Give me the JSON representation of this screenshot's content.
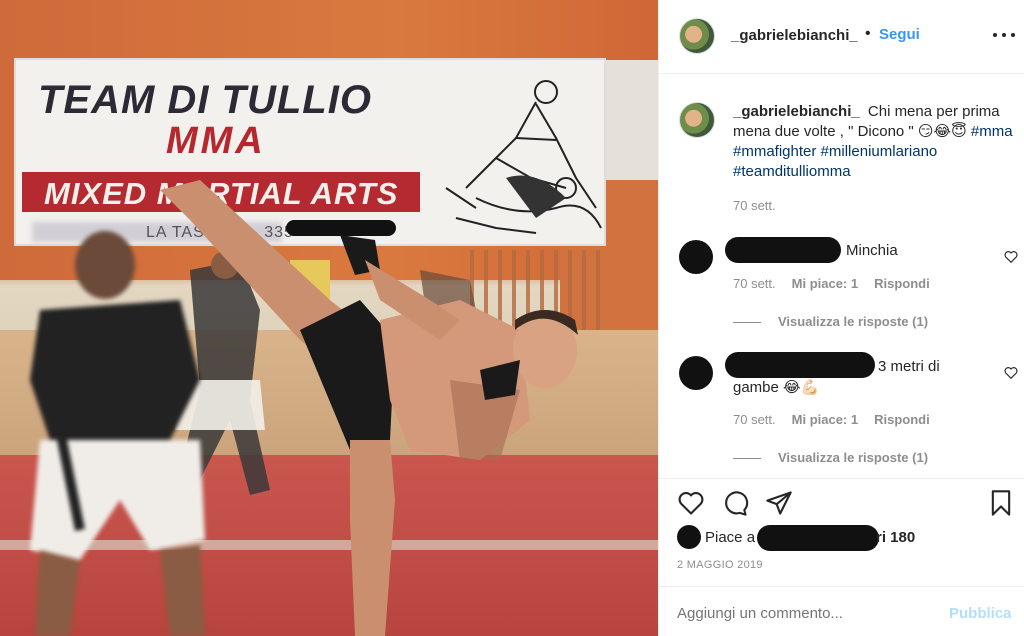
{
  "photo": {
    "banner_title": "TEAM DI TULLIO",
    "banner_mma": "MMA",
    "banner_strip": "MIXED MARTIAL ARTS",
    "banner_sub": "LA TASSIMA - 335"
  },
  "header": {
    "username": "_gabrielebianchi_",
    "separator": "•",
    "follow_label": "Segui"
  },
  "caption": {
    "username": "_gabrielebianchi_",
    "text": "Chi mena per prima mena due volte , \" Dicono \" 😏😂😇",
    "hashtags": [
      "#mma",
      "#mmafighter",
      "#milleniumlariano",
      "#teamditulliomma"
    ],
    "time": "70 sett."
  },
  "comments": [
    {
      "text": "Minchia",
      "time": "70 sett.",
      "likes": "Mi piace: 1",
      "reply": "Rispondi",
      "view_replies": "Visualizza le risposte (1)"
    },
    {
      "text": "3 metri di",
      "text_line2": "gambe 😂💪🏻",
      "time": "70 sett.",
      "likes": "Mi piace: 1",
      "reply": "Rispondi",
      "view_replies": "Visualizza le risposte (1)"
    }
  ],
  "likes": {
    "prefix": "Piace a",
    "suffix": "ri 180",
    "date": "2 MAGGIO 2019"
  },
  "add_comment": {
    "placeholder": "Aggiungi un commento...",
    "publish_label": "Pubblica"
  },
  "icons": [
    "heart-icon",
    "comment-icon",
    "share-icon",
    "bookmark-icon",
    "more-options-icon"
  ]
}
